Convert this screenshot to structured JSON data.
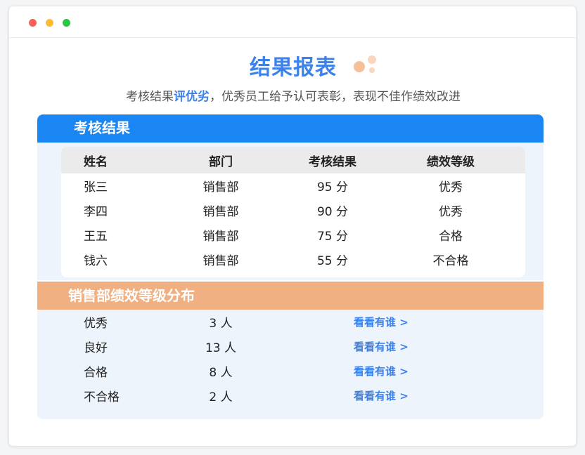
{
  "window": {
    "controls": [
      "close",
      "minimize",
      "maximize"
    ]
  },
  "header": {
    "title": "结果报表",
    "subtitle_prefix": "考核结果",
    "subtitle_highlight": "评优劣",
    "subtitle_suffix": "，优秀员工给予认可表彰，表现不佳作绩效改进"
  },
  "results": {
    "title": "考核结果",
    "columns": [
      "姓名",
      "部门",
      "考核结果",
      "绩效等级"
    ],
    "rows": [
      [
        "张三",
        "销售部",
        "95 分",
        "优秀"
      ],
      [
        "李四",
        "销售部",
        "90 分",
        "优秀"
      ],
      [
        "王五",
        "销售部",
        "75 分",
        "合格"
      ],
      [
        "钱六",
        "销售部",
        "55 分",
        "不合格"
      ]
    ]
  },
  "distribution": {
    "title": "销售部绩效等级分布",
    "rows": [
      {
        "grade": "优秀",
        "count": "3 人",
        "link": "看看有谁 >"
      },
      {
        "grade": "良好",
        "count": "13 人",
        "link": "看看有谁 >"
      },
      {
        "grade": "合格",
        "count": "8 人",
        "link": "看看有谁 >"
      },
      {
        "grade": "不合格",
        "count": "2 人",
        "link": "看看有谁 >"
      }
    ]
  },
  "colors": {
    "accent_blue": "#1a86f4",
    "title_blue": "#3d82e8",
    "accent_orange": "#f0b082",
    "panel_bg": "#eef4fb"
  }
}
